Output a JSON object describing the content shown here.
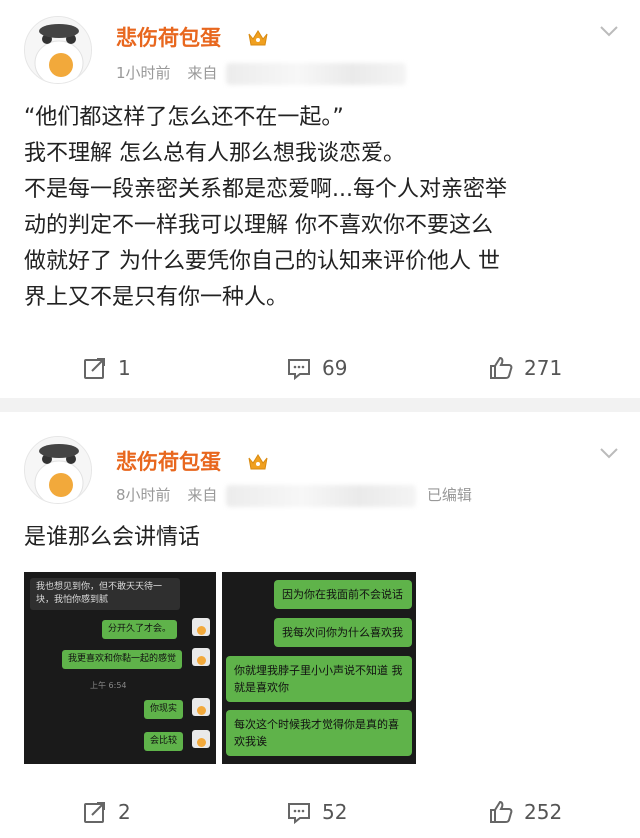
{
  "post1": {
    "author": "悲伤荷包蛋",
    "time": "1小时前",
    "from_label": "来自",
    "text_lines": [
      "“他们都这样了怎么还不在一起。”",
      "我不理解 怎么总有人那么想我谈恋爱。",
      "不是每一段亲密关系都是恋爱啊...每个人对亲密举",
      "动的判定不一样我可以理解 你不喜欢你不要这么",
      "做就好了 为什么要凭你自己的认知来评价他人 世",
      "界上又不是只有你一种人。"
    ],
    "repost_count": "1",
    "comment_count": "69",
    "like_count": "271"
  },
  "post2": {
    "author": "悲伤荷包蛋",
    "time": "8小时前",
    "from_label": "来自",
    "edited": "已编辑",
    "text": "是谁那么会讲情话",
    "image1": {
      "msg1": "我也想见到你，但不敢天天待一块，我怕你感到腻",
      "msg2": "分开久了才会。",
      "msg3": "我更喜欢和你黏一起的感觉",
      "time": "上午 6:54",
      "msg4": "你现实",
      "msg5": "会比较"
    },
    "image2": {
      "msg1": "因为你在我面前不会说话",
      "msg2": "我每次问你为什么喜欢我",
      "msg3": "你就埋我脖子里小小声说不知道 我就是喜欢你",
      "msg4": "每次这个时候我才觉得你是真的喜欢我诶"
    },
    "repost_count": "2",
    "comment_count": "52",
    "like_count": "252"
  },
  "icons": {
    "crown": "crown-badge-icon",
    "repost": "repost-icon",
    "comment": "comment-icon",
    "like": "thumbs-up-icon",
    "menu": "chevron-down-icon"
  },
  "colors": {
    "author": "#e8671e",
    "crown": "#f0a020",
    "bubble_green": "#5fb34a"
  }
}
